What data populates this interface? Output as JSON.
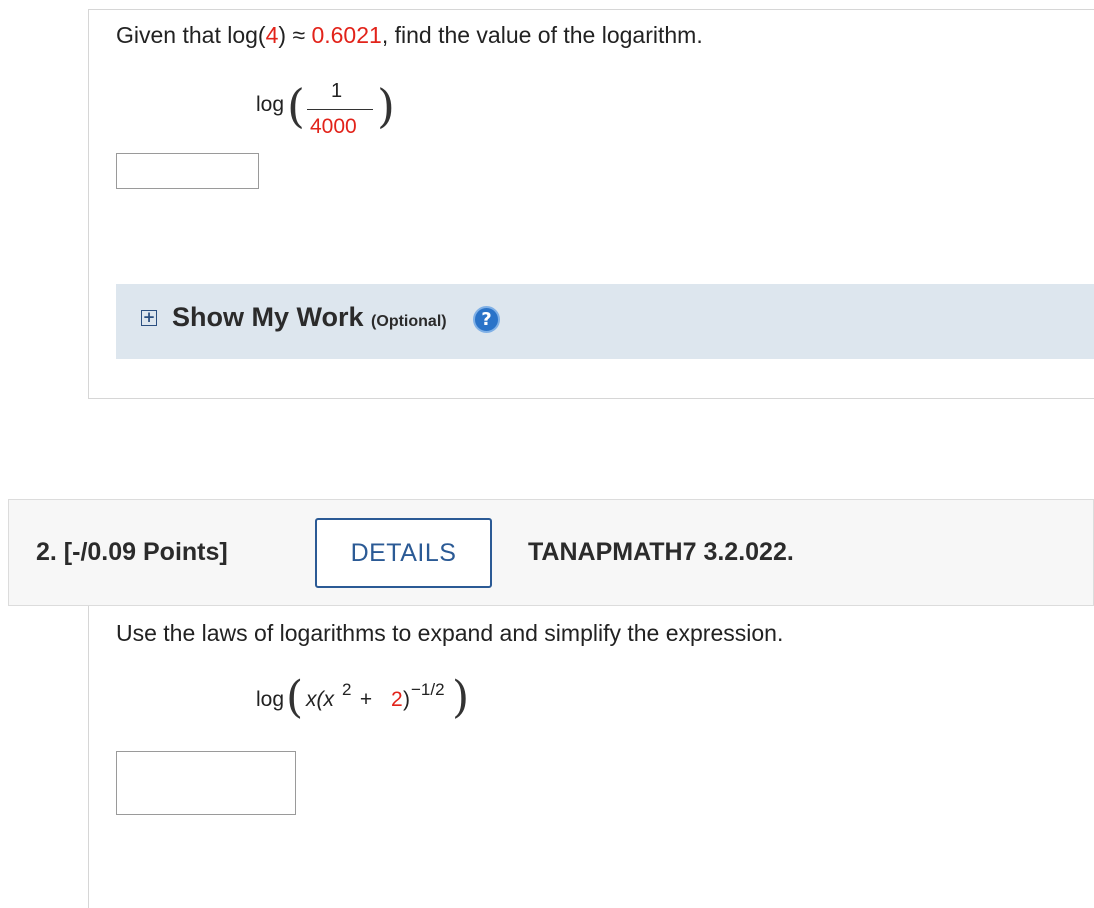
{
  "question1": {
    "prompt_prefix": "Given that log(",
    "given_arg": "4",
    "prompt_mid": ") ≈ ",
    "given_value": "0.6021",
    "prompt_suffix": ", find the value of the logarithm.",
    "expr_log": "log",
    "numerator": "1",
    "denominator": "4000",
    "answer_value": ""
  },
  "show_work": {
    "toggle_symbol": "+",
    "title": "Show My Work",
    "optional": "(Optional)",
    "help_symbol": "?"
  },
  "question2": {
    "number_points": "2.  [-/0.09 Points]",
    "details_label": "DETAILS",
    "code": "TANAPMATH7 3.2.022.",
    "prompt": "Use the laws of logarithms to expand and simplify the expression.",
    "expr_log": "log",
    "expr_x": "x(x",
    "expr_exp2": "2",
    "expr_plus": " + ",
    "expr_const": "2",
    "expr_close": ")",
    "expr_outer_exp": "−1/2",
    "answer_value": ""
  },
  "colors": {
    "accent": "#2b5a95",
    "highlight_red": "#e2231a",
    "work_bar_bg": "#dde6ee"
  }
}
